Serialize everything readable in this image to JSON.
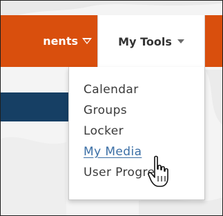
{
  "navbar": {
    "partial_item_label": "nents",
    "active_item_label": "My Tools",
    "brand_color": "#d94f0d",
    "secondary_color": "#163f64"
  },
  "dropdown": {
    "items": [
      {
        "label": "Calendar",
        "state": "normal"
      },
      {
        "label": "Groups",
        "state": "normal"
      },
      {
        "label": "Locker",
        "state": "normal"
      },
      {
        "label": "My Media",
        "state": "hover"
      },
      {
        "label": "User Progress",
        "state": "normal"
      }
    ],
    "hover_color": "#3a6ea5"
  },
  "icons": {
    "nav_dropdown_icon": "triangle-down-outline",
    "mytools_caret_icon": "caret-down",
    "cursor_icon": "hand-pointer"
  }
}
